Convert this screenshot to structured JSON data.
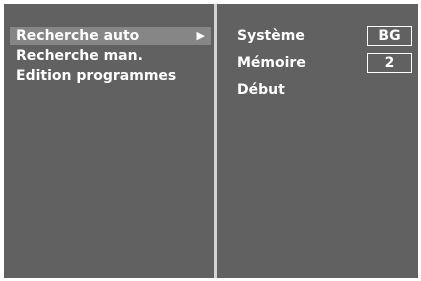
{
  "menu": {
    "items": [
      {
        "label": "Recherche auto",
        "selected": true,
        "arrow": "▶"
      },
      {
        "label": "Recherche man.",
        "selected": false
      },
      {
        "label": "Edition programmes",
        "selected": false
      }
    ]
  },
  "settings": {
    "systeme": {
      "label": "Système",
      "value": "BG"
    },
    "memoire": {
      "label": "Mémoire",
      "value": "2"
    },
    "debut": {
      "label": "Début"
    }
  },
  "colors": {
    "background": "#616161",
    "highlight": "#868686",
    "divider": "#d4d4d4",
    "text": "#ffffff"
  }
}
